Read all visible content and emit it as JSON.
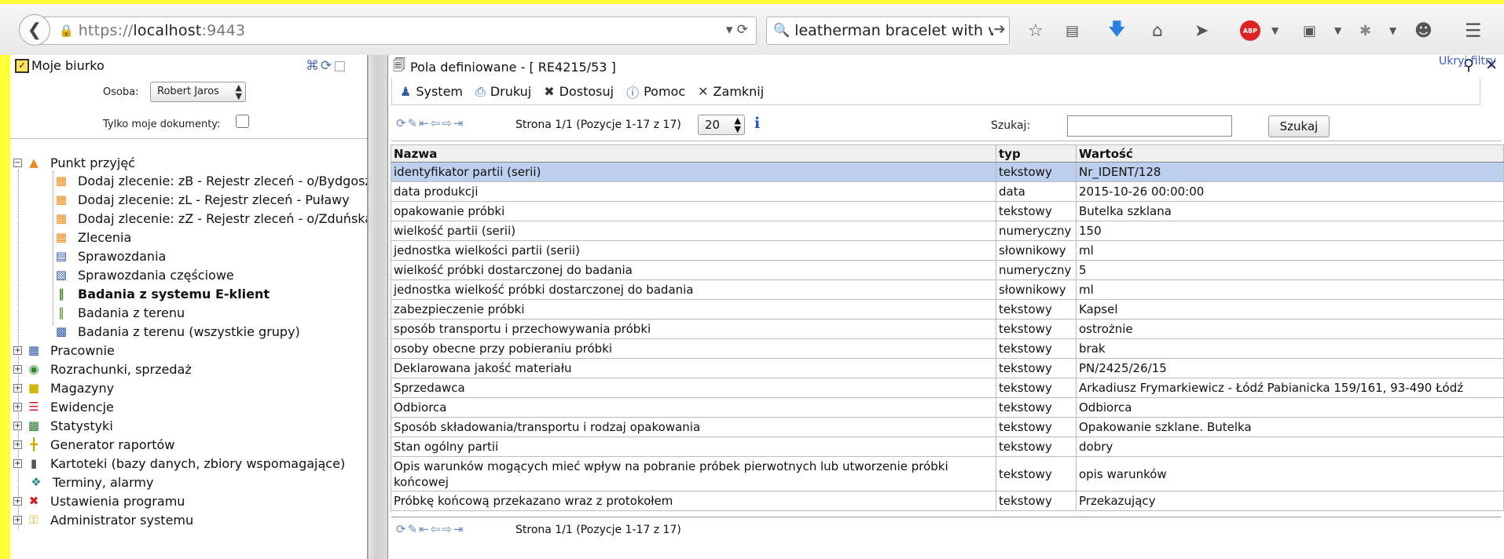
{
  "browser": {
    "url_scheme": "https://",
    "url_host": "localhost",
    "url_port": ":9443",
    "search_text": "leatherman bracelet with v"
  },
  "left": {
    "title": "Moje biurko",
    "osoba_label": "Osoba:",
    "osoba_value": "Robert Jaros",
    "tylko_label": "Tylko moje dokumenty:",
    "tree": [
      {
        "label": "Punkt przyjęć",
        "icon": "flask-icon"
      },
      {
        "label": "Dodaj zlecenie: zB - Rejestr zleceń - o/Bydgoszcz",
        "icon": "order-icon"
      },
      {
        "label": "Dodaj zlecenie: zL - Rejestr zleceń - Puławy",
        "icon": "order-icon"
      },
      {
        "label": "Dodaj zlecenie: zZ - Rejestr zleceń - o/Zduńska Wola",
        "icon": "order-icon"
      },
      {
        "label": "Zlecenia",
        "icon": "order-icon"
      },
      {
        "label": "Sprawozdania",
        "icon": "report-icon"
      },
      {
        "label": "Sprawozdania częściowe",
        "icon": "partial-report-icon"
      },
      {
        "label": "Badania z systemu E-klient",
        "icon": "test-tube-icon"
      },
      {
        "label": "Badania z terenu",
        "icon": "test-tube-icon"
      },
      {
        "label": "Badania z terenu (wszystkie grupy)",
        "icon": "groups-icon"
      },
      {
        "label": "Pracownie",
        "icon": "network-icon"
      },
      {
        "label": "Rozrachunki, sprzedaż",
        "icon": "money-icon"
      },
      {
        "label": "Magazyny",
        "icon": "box-icon"
      },
      {
        "label": "Ewidencje",
        "icon": "stack-icon"
      },
      {
        "label": "Statystyki",
        "icon": "stats-icon"
      },
      {
        "label": "Generator raportów",
        "icon": "generator-icon"
      },
      {
        "label": "Kartoteki (bazy danych, zbiory wspomagające)",
        "icon": "cabinet-icon"
      },
      {
        "label": "Terminy, alarmy",
        "icon": "alarm-icon"
      },
      {
        "label": "Ustawienia programu",
        "icon": "tools-icon"
      },
      {
        "label": "Administrator systemu",
        "icon": "keys-icon"
      }
    ]
  },
  "right": {
    "title": "Pola definiowane - [ RE4215/53 ]",
    "menu": {
      "system": "System",
      "drukuj": "Drukuj",
      "dostosuj": "Dostosuj",
      "pomoc": "Pomoc",
      "zamknij": "Zamknij"
    },
    "pager_text": "Strona 1/1 (Pozycje 1-17 z 17)",
    "page_size": "20",
    "szukaj_label": "Szukaj:",
    "szukaj_button": "Szukaj",
    "ukryj_filtry": "Ukryj filtry",
    "columns": [
      "Nazwa",
      "typ",
      "Wartość"
    ],
    "rows": [
      [
        "identyfikator partii (serii)",
        "tekstowy",
        "Nr_IDENT/128"
      ],
      [
        "data produkcji",
        "data",
        "2015-10-26 00:00:00"
      ],
      [
        "opakowanie próbki",
        "tekstowy",
        "Butelka szklana"
      ],
      [
        "wielkość partii (serii)",
        "numeryczny",
        "150"
      ],
      [
        "jednostka wielkości partii (serii)",
        "słownikowy",
        "ml"
      ],
      [
        "wielkość próbki dostarczonej do badania",
        "numeryczny",
        "5"
      ],
      [
        "jednostka wielkość próbki dostarczonej do badania",
        "słownikowy",
        "ml"
      ],
      [
        "zabezpieczenie próbki",
        "tekstowy",
        "Kapsel"
      ],
      [
        "sposób transportu i przechowywania próbki",
        "tekstowy",
        "ostrożnie"
      ],
      [
        "osoby obecne przy pobieraniu próbki",
        "tekstowy",
        "brak"
      ],
      [
        "Deklarowana jakość materiału",
        "tekstowy",
        "PN/2425/26/15"
      ],
      [
        "Sprzedawca",
        "tekstowy",
        "Arkadiusz Frymarkiewicz - Łódź Pabianicka 159/161, 93-490 Łódź"
      ],
      [
        "Odbiorca",
        "tekstowy",
        "Odbiorca"
      ],
      [
        "Sposób składowania/transportu i rodzaj opakowania",
        "tekstowy",
        "Opakowanie szklane. Butelka"
      ],
      [
        "Stan ogólny partii",
        "tekstowy",
        "dobry"
      ],
      [
        "Opis warunków mogących mieć wpływ na pobranie próbek pierwotnych lub utworzenie próbki końcowej",
        "tekstowy",
        "opis warunków"
      ],
      [
        "Próbkę końcową przekazano wraz z protokołem",
        "tekstowy",
        "Przekazujący"
      ]
    ]
  }
}
